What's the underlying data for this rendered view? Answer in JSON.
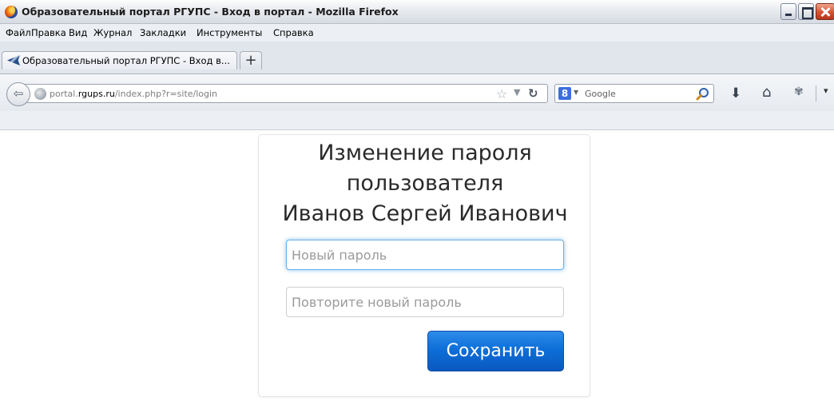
{
  "window": {
    "title": "Образовательный портал РГУПС - Вход в портал - Mozilla Firefox"
  },
  "menu": {
    "items": [
      "Файл",
      "Правка",
      "Вид",
      "Журнал",
      "Закладки",
      "Инструменты",
      "Справка"
    ]
  },
  "tabs": [
    {
      "label": "Образовательный портал РГУПС - Вход в...",
      "active": true
    }
  ],
  "new_tab_symbol": "+",
  "navbar": {
    "url_domain_prefix": "portal.",
    "url_domain_main": "rgups.ru",
    "url_path": "/index.php?r=site/login",
    "search_engine_letter": "8",
    "search_engine": "Google",
    "icons": [
      "back-icon",
      "globe-icon",
      "bookmark-star-icon",
      "dropdown-icon",
      "reload-icon",
      "google-icon",
      "magnifier-icon",
      "download-icon",
      "home-icon",
      "addon-icon",
      "overflow-icon"
    ]
  },
  "form": {
    "heading_line1": "Изменение пароля",
    "heading_line2": "пользователя",
    "heading_line3": "Иванов Сергей Иванович",
    "new_password_placeholder": "Новый пароль",
    "repeat_password_placeholder": "Повторите новый пароль",
    "save_label": "Сохранить",
    "save_color": "#0d6fd8",
    "focus_color": "#66afe9"
  }
}
